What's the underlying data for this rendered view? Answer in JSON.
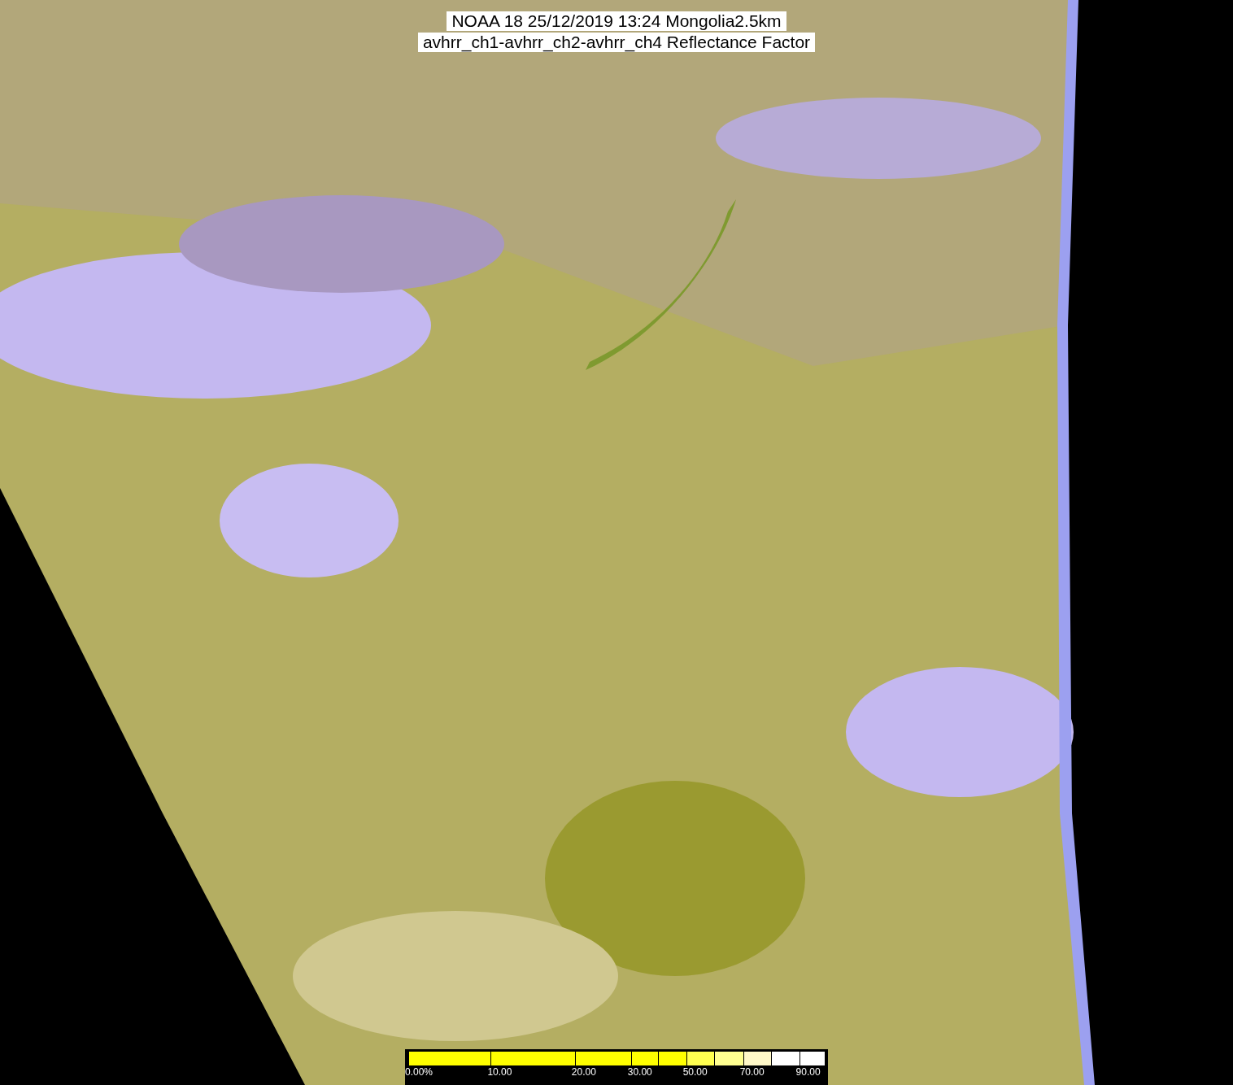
{
  "title": {
    "line_1": "NOAA 18 25/12/2019 13:24 Mongolia2.5km",
    "line_2": "avhrr_ch1-avhrr_ch2-avhrr_ch4 Reflectance Factor"
  },
  "legend": {
    "segments": [
      {
        "color": "#ffff00",
        "label": "0.00%"
      },
      {
        "color": "#ffff00",
        "label": "10.00"
      },
      {
        "color": "#ffff00",
        "label": "20.00"
      },
      {
        "color": "#ffff00",
        "label": "30.00"
      },
      {
        "color": "#ffff00"
      },
      {
        "color": "#ffff50",
        "label": "50.00"
      },
      {
        "color": "#ffff90"
      },
      {
        "color": "#fff8c8",
        "label": "70.00"
      },
      {
        "color": "#ffffff"
      },
      {
        "color": "#ffffff",
        "label": "90.00"
      }
    ]
  }
}
